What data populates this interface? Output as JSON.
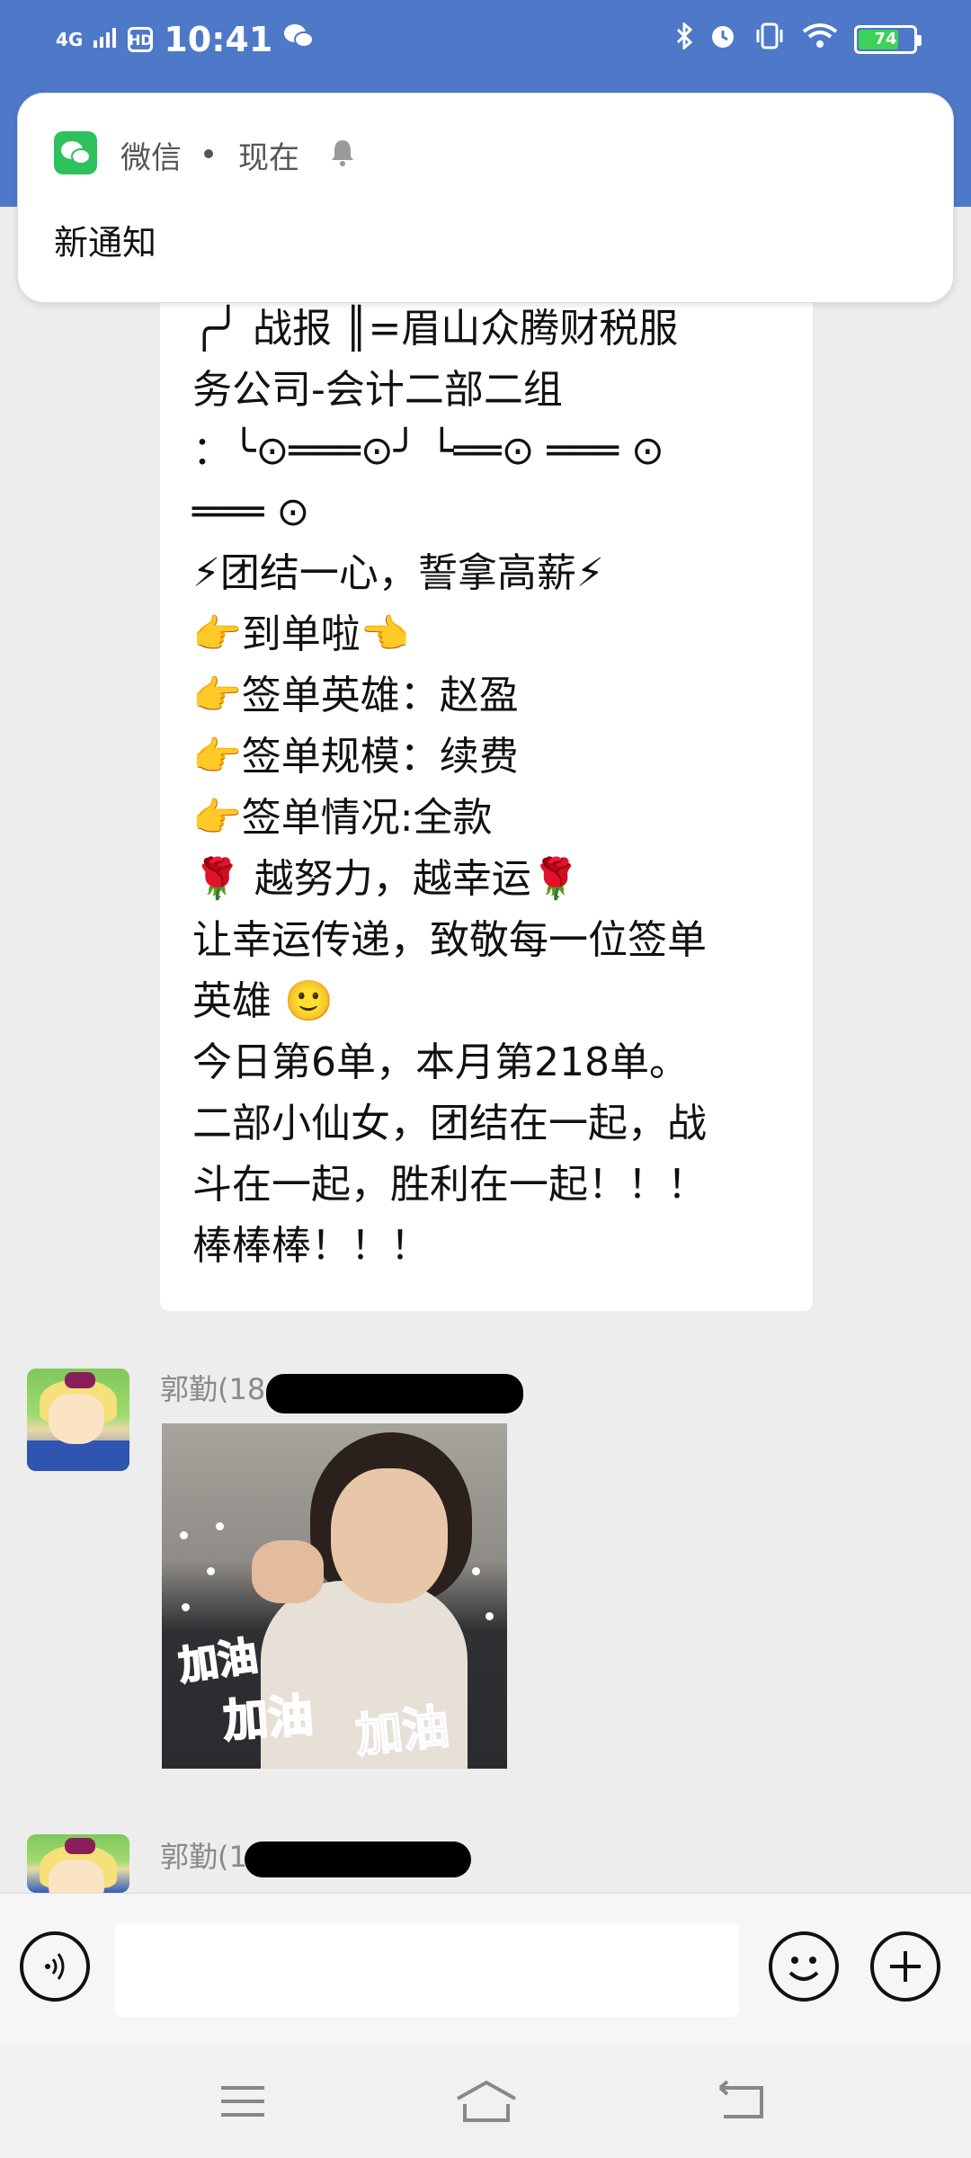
{
  "status_bar": {
    "signal": "4G",
    "hd": "HD",
    "time": "10:41",
    "battery": "74",
    "battery_level": 0.74
  },
  "notification": {
    "app_name": "微信",
    "time": "现在",
    "body": "新通知"
  },
  "message": {
    "lines": [
      "╭╯ 战报 ║=眉山众腾财税服",
      "务公司-会计二部二组",
      "：╰⊙═══⊙╯ └══⊙ ═══ ⊙",
      "═══ ⊙",
      "⚡团结一心，誓拿高薪⚡",
      "👉到单啦👈",
      "👉签单英雄：赵盈",
      "👉签单规模：续费",
      "👉签单情况:全款",
      "🌹 越努力，越幸运🌹",
      "让幸运传递，致敬每一位签单",
      "英雄 🙂",
      "今日第6单，本月第218单。",
      "二部小仙女，团结在一起，战",
      "斗在一起，胜利在一起！！！",
      "棒棒棒！！！"
    ]
  },
  "chat": {
    "sender1": "郭勤(18",
    "sender2": "郭勤(1",
    "sticker_text": [
      "加油",
      "加油",
      "加油"
    ]
  },
  "input": {
    "value": ""
  },
  "colors": {
    "header": "#4E79C8",
    "wechat_green": "#2DC15C",
    "chat_bg": "#EDEDED"
  }
}
